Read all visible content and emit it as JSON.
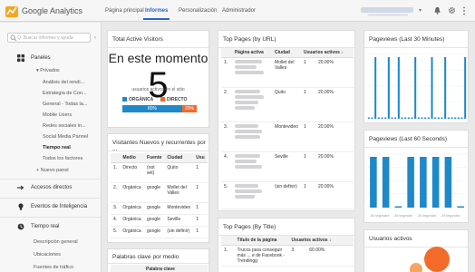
{
  "header": {
    "brand": "Google Analytics",
    "nav": [
      {
        "label": "Página principal",
        "active": false
      },
      {
        "label": "Informes",
        "active": true
      },
      {
        "label": "Personalización",
        "active": false
      },
      {
        "label": "Administrador",
        "active": false
      }
    ]
  },
  "sidebar": {
    "search_placeholder": "Q. Buscar informes y ayuda",
    "items": [
      {
        "label": "Paneles",
        "icon": "grid-icon",
        "level": 0
      },
      {
        "label": "▾ Privados",
        "level": 1
      },
      {
        "label": "Análisis del rendi...",
        "level": 2
      },
      {
        "label": "Estrategia de Con...",
        "level": 2
      },
      {
        "label": "General - Todas la...",
        "level": 2
      },
      {
        "label": "Mobile Users",
        "level": 2
      },
      {
        "label": "Redes sociales in...",
        "level": 2
      },
      {
        "label": "Social Media Pannel",
        "level": 2
      },
      {
        "label": "Tiempo real",
        "level": 2,
        "bold": true
      },
      {
        "label": "Todos los factores",
        "level": 2
      },
      {
        "label": "+ Nuevo panel",
        "level": 1
      },
      {
        "label": "Accesos directos",
        "icon": "shortcut-icon",
        "level": 0
      },
      {
        "label": "Eventos de Inteligencia",
        "icon": "lightbulb-icon",
        "level": 0
      },
      {
        "label": "Tiempo real",
        "icon": "clock-icon",
        "level": 0
      },
      {
        "label": "Descripción general",
        "level": 2
      },
      {
        "label": "Ubicaciones",
        "level": 2
      },
      {
        "label": "Fuentes de tráfico",
        "level": 2
      }
    ]
  },
  "total_visitors": {
    "title": "Total Active Visitors",
    "headline": "En este momento",
    "count": "5",
    "subtitle": "usuarios activos en el sitio",
    "legend_organic": "ORGÁNICA",
    "legend_direct": "DIRECTO",
    "organic_pct": "80%",
    "direct_pct": "20%",
    "organic_fraction": 0.8,
    "direct_fraction": 0.2,
    "colors": {
      "organic": "#1e88c9",
      "direct": "#f26b2b"
    }
  },
  "visitors_table": {
    "title": "Visitantes Nuevos y recurrentes por ...",
    "headers": [
      "",
      "Medio",
      "Fuente",
      "Ciudad",
      "Usu"
    ],
    "rows": [
      [
        "1.",
        "Directo",
        "(not set)",
        "Quito",
        "1"
      ],
      [
        "2.",
        "Orgánica",
        "google",
        "Mollet del Valles",
        "1"
      ],
      [
        "3.",
        "Orgánica",
        "google",
        "Montevideo",
        "1"
      ],
      [
        "4.",
        "Orgánica",
        "google",
        "Seville",
        "1"
      ],
      [
        "5.",
        "Orgánica",
        "google",
        "(sin definir)",
        "1"
      ]
    ]
  },
  "keywords": {
    "title": "Palabras clave por medio",
    "headers": [
      "",
      "Palabra clave"
    ]
  },
  "top_pages_url": {
    "title": "Top Pages (by URL)",
    "headers": [
      "",
      "Página activa",
      "Ciudad",
      "Usuarios activos ↓"
    ],
    "rows": [
      [
        "1.",
        "Mollet del Valles",
        "1",
        "20.00%"
      ],
      [
        "2.",
        "Quito",
        "1",
        "20.00%"
      ],
      [
        "3.",
        "Montevideo",
        "1",
        "20.00%"
      ],
      [
        "4.",
        "Seville",
        "1",
        "20.00%"
      ],
      [
        "5.",
        "(sin definir)",
        "1",
        "20.00%"
      ]
    ]
  },
  "top_pages_title": {
    "title": "Top Pages (By Title)",
    "headers": [
      "",
      "Título de la página",
      "Usuarios activos ↓"
    ],
    "rows": [
      [
        "1.",
        "Trucos para conseguir más ... e de Facebook - Trendingg",
        "3",
        "60.00%"
      ]
    ]
  },
  "pageviews_30": {
    "title": "Pageviews (Last 30 Minutes)",
    "values": [
      0,
      0,
      1,
      0,
      0,
      0,
      1,
      0,
      0,
      1,
      0,
      0,
      0,
      0,
      1,
      0,
      0,
      0,
      0,
      1,
      0,
      0,
      0,
      1,
      0,
      0,
      0,
      0,
      0,
      1
    ],
    "color": "#1e88c9"
  },
  "pageviews_60": {
    "title": "Pageviews (Last 60 Seconds)",
    "axis_labels": [
      "-60 segundos",
      "-45 segundos",
      "-30 segundos",
      "-15 segundos"
    ],
    "values": [
      1,
      1,
      0,
      1,
      1,
      1,
      1,
      0
    ],
    "color": "#1e88c9"
  },
  "active_users": {
    "title": "Usuarios activos",
    "colors": {
      "big": "#f26b2b",
      "small": "#f7a55f"
    }
  }
}
